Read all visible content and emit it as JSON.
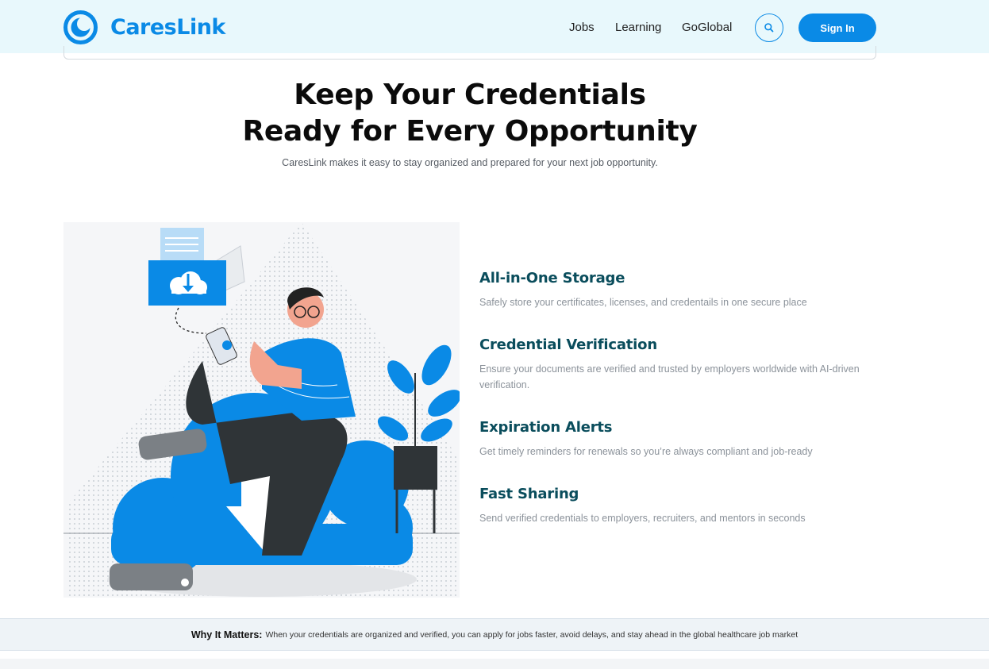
{
  "header": {
    "brand": "CaresLink",
    "nav": [
      {
        "label": "Jobs"
      },
      {
        "label": "Learning"
      },
      {
        "label": "GoGlobal"
      }
    ],
    "search_icon": "search-icon",
    "signin_label": "Sign In",
    "brand_color": "#0a8ae6"
  },
  "hero": {
    "title_line1": "Keep Your Credentials",
    "title_line2": "Ready for Every Opportunity",
    "subtitle": "CaresLink makes it easy to stay organized and prepared for your next job opportunity."
  },
  "illustration": {
    "icon": "person-with-phone-cloud-upload-illustration"
  },
  "features": [
    {
      "title": "All-in-One Storage",
      "desc": "Safely store your certificates, licenses, and credentails in one secure place"
    },
    {
      "title": "Credential Verification",
      "desc": "Ensure your documents are verified and trusted by employers worldwide with AI-driven verification."
    },
    {
      "title": "Expiration Alerts",
      "desc": "Get timely reminders for renewals so you’re always compliant and job-ready"
    },
    {
      "title": "Fast Sharing",
      "desc": "Send verified credentials to employers, recruiters, and mentors in seconds"
    }
  ],
  "banner": {
    "label": "Why It Matters:",
    "text": "When your credentials are organized and verified, you can apply for jobs faster, avoid delays, and stay ahead in the global healthcare job market"
  }
}
